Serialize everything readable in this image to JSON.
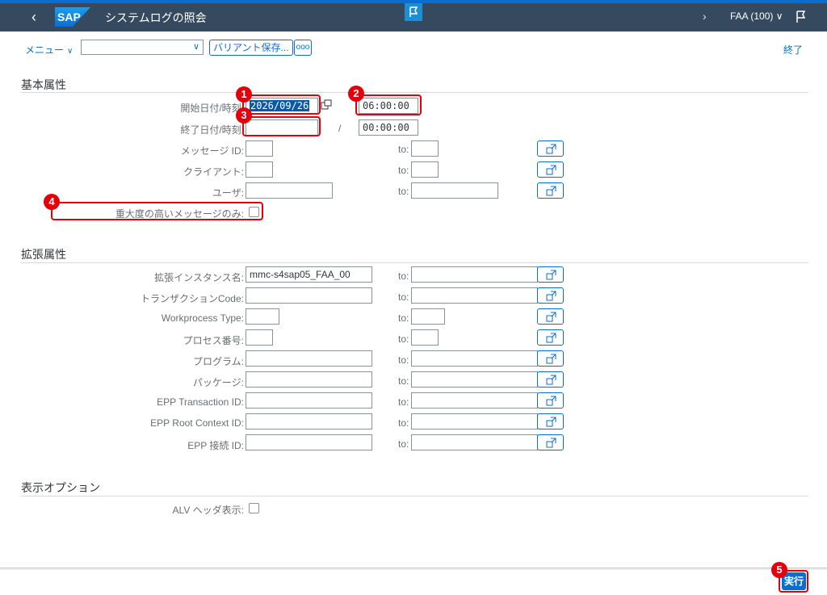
{
  "shell": {
    "title": "システムログの照会",
    "logo_text": "SAP",
    "system": "FAA (100)",
    "colors": {
      "shell_bg": "#354a5f",
      "accent": "#0a6ed1",
      "highlight": "#e3000b"
    }
  },
  "toolbar": {
    "menu_label": "メニュー",
    "variant_value": "",
    "variant_save_label": "バリアント保存...",
    "more_label": "ooo",
    "exit_label": "終了"
  },
  "basic": {
    "section_title": "基本属性",
    "start_label": "開始日付/時刻:",
    "start_date": "2026/09/26",
    "start_time": "06:00:00",
    "end_label": "終了日付/時刻:",
    "end_date": "",
    "separator": "/",
    "end_time": "00:00:00",
    "message_id_label": "メッセージ ID:",
    "client_label": "クライアント:",
    "user_label": "ユーザ:",
    "to_label": "to:",
    "high_severity_label": "重大度の高いメッセージのみ:"
  },
  "extended": {
    "section_title": "拡張属性",
    "rows": [
      {
        "label": "拡張インスタンス名:",
        "value": "mmc-s4sap05_FAA_00"
      },
      {
        "label": "トランザクションCode:",
        "value": ""
      },
      {
        "label": "Workprocess Type:",
        "value": ""
      },
      {
        "label": "プロセス番号:",
        "value": ""
      },
      {
        "label": "プログラム:",
        "value": ""
      },
      {
        "label": "パッケージ:",
        "value": ""
      },
      {
        "label": "EPP Transaction ID:",
        "value": ""
      },
      {
        "label": "EPP Root Context ID:",
        "value": ""
      },
      {
        "label": "EPP 接続 ID:",
        "value": ""
      }
    ]
  },
  "display": {
    "section_title": "表示オプション",
    "alv_label": "ALV ヘッダ表示:"
  },
  "footer": {
    "execute_label": "実行"
  },
  "annotations": [
    "1",
    "2",
    "3",
    "4",
    "5"
  ]
}
